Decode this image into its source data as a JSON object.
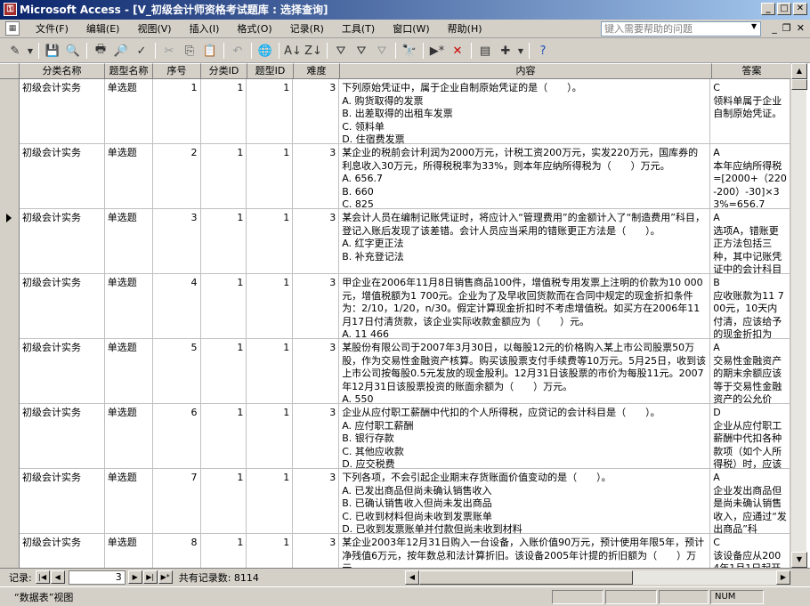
{
  "window": {
    "app_icon": "access-key-icon",
    "title": "Microsoft Access - [V_初级会计师资格考试题库 : 选择查询]"
  },
  "menu": {
    "items": [
      "文件(F)",
      "编辑(E)",
      "视图(V)",
      "插入(I)",
      "格式(O)",
      "记录(R)",
      "工具(T)",
      "窗口(W)",
      "帮助(H)"
    ],
    "help_placeholder": "键入需要帮助的问题"
  },
  "toolbar": {
    "icons": [
      "view-icon",
      "save-icon",
      "search-file-icon",
      "print-icon",
      "print-preview-icon",
      "spelling-icon",
      "cut-icon",
      "copy-icon",
      "paste-icon",
      "undo-icon",
      "hyperlink-icon",
      "sort-ascending-icon",
      "sort-descending-icon",
      "filter-by-selection-icon",
      "filter-by-form-icon",
      "apply-filter-icon",
      "find-icon",
      "new-record-icon",
      "delete-record-icon",
      "database-window-icon",
      "new-object-icon",
      "help-icon"
    ]
  },
  "table": {
    "columns": [
      "分类名称",
      "题型名称",
      "序号",
      "分类ID",
      "题型ID",
      "难度",
      "内容",
      "答案"
    ],
    "current_row_index": 2,
    "rows": [
      {
        "category": "初级会计实务",
        "type": "单选题",
        "seq": "1",
        "cat_id": "1",
        "type_id": "1",
        "difficulty": "3",
        "content": "下列原始凭证中，属于企业自制原始凭证的是（　　）。\nA. 购货取得的发票\nB. 出差取得的出租车发票\nC. 领料单\nD. 住宿费发票",
        "answer": "C\n领料单属于企业自制原始凭证。"
      },
      {
        "category": "初级会计实务",
        "type": "单选题",
        "seq": "2",
        "cat_id": "1",
        "type_id": "1",
        "difficulty": "3",
        "content": "某企业的税前会计利润为2000万元，计税工资200万元，实发220万元，国库券的利息收入30万元，所得税税率为33%，则本年应纳所得税为（　　）万元。\nA. 656.7\nB. 660\nC. 825",
        "answer": "A\n本年应纳所得税=[2000+（220-200）-30]×33%=656.7"
      },
      {
        "category": "初级会计实务",
        "type": "单选题",
        "seq": "3",
        "cat_id": "1",
        "type_id": "1",
        "difficulty": "3",
        "content": "某会计人员在编制记账凭证时，将应计入“管理费用”的金额计入了“制造费用”科目，登记入账后发现了该差错。会计人员应当采用的错账更正方法是（　　）。\nA. 红字更正法\nB. 补充登记法",
        "answer": "A\n选项A，错账更正方法包括三种，其中记账凭证中的会计科目"
      },
      {
        "category": "初级会计实务",
        "type": "单选题",
        "seq": "4",
        "cat_id": "1",
        "type_id": "1",
        "difficulty": "3",
        "content": "甲企业在2006年11月8日销售商品100件，增值税专用发票上注明的价款为10 000元，增值税额为1 700元。企业为了及早收回货款而在合同中规定的现金折扣条件为：2/10，1/20，n/30。假定计算现金折扣时不考虑增值税。如买方在2006年11月17日付清货款，该企业实际收款金额应为（　　）元。\nA. 11 466",
        "answer": "B\n应收账款为11 700元，10天内付清，应该给予的现金折扣为"
      },
      {
        "category": "初级会计实务",
        "type": "单选题",
        "seq": "5",
        "cat_id": "1",
        "type_id": "1",
        "difficulty": "3",
        "content": "某股份有限公司于2007年3月30日，以每股12元的价格购入某上市公司股票50万股，作为交易性金融资产核算。购买该股票支付手续费等10万元。5月25日，收到该上市公司按每股0.5元发放的现金股利。12月31日该股票的市价为每股11元。2007年12月31日该股票投资的账面余额为（　　）万元。\nA. 550",
        "answer": "A\n交易性金融资产的期末余额应该等于交易性金融资产的公允价"
      },
      {
        "category": "初级会计实务",
        "type": "单选题",
        "seq": "6",
        "cat_id": "1",
        "type_id": "1",
        "difficulty": "3",
        "content": "企业从应付职工薪酬中代扣的个人所得税，应贷记的会计科目是（　　）。\nA. 应付职工薪酬\nB. 银行存款\nC. 其他应收款\nD. 应交税费",
        "answer": "D\n企业从应付职工薪酬中代扣各种款项（如个人所得税）时，应该"
      },
      {
        "category": "初级会计实务",
        "type": "单选题",
        "seq": "7",
        "cat_id": "1",
        "type_id": "1",
        "difficulty": "3",
        "content": "下列各项，不会引起企业期末存货账面价值变动的是（　　）。\nA. 已发出商品但尚未确认销售收入\nB. 已确认销售收入但尚未发出商品\nC. 已收到材料但尚未收到发票账单\nD. 已收到发票账单并付款但尚未收到材料",
        "answer": "A\n企业发出商品但是尚未确认销售收入，应通过“发出商品”科"
      },
      {
        "category": "初级会计实务",
        "type": "单选题",
        "seq": "8",
        "cat_id": "1",
        "type_id": "1",
        "difficulty": "3",
        "content": "某企业2003年12月31日购入一台设备，入账价值90万元，预计使用年限5年，预计净残值6万元，按年数总和法计算折旧。该设备2005年计提的折旧额为（　　）万元。",
        "answer": "C\n该设备应从2004年1月1日起开始"
      }
    ]
  },
  "navigation": {
    "label": "记录:",
    "current_record": "3",
    "total_label": "共有记录数: 8114"
  },
  "status": {
    "view_text": "“数据表”视图",
    "num_lock": "NUM"
  }
}
